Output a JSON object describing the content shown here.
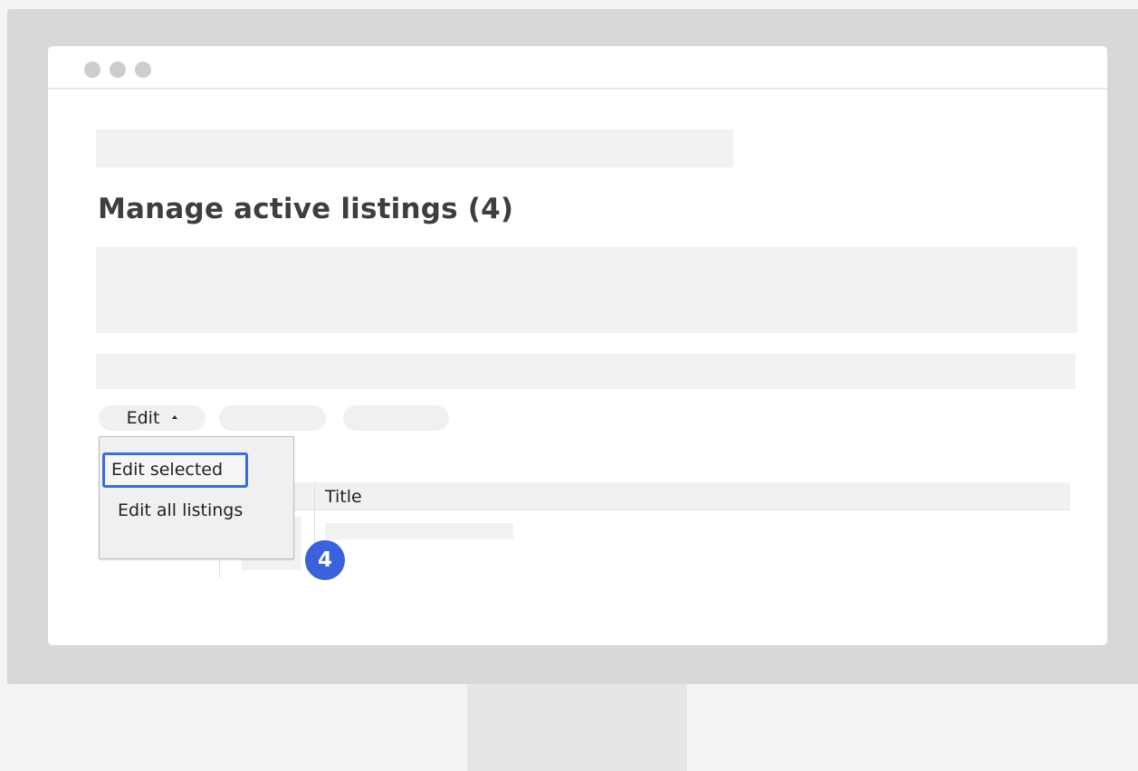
{
  "page": {
    "title": "Manage active listings (4)"
  },
  "toolbar": {
    "edit_label": "Edit",
    "caret_icon": "caret-up-icon"
  },
  "dropdown": {
    "items": [
      {
        "label": "Edit selected",
        "state": "focused"
      },
      {
        "label": "Edit all listings"
      }
    ]
  },
  "table": {
    "columns": [
      "",
      "",
      "Title"
    ]
  },
  "annotation": {
    "step_number": "4"
  },
  "colors": {
    "accent": "#3b62dc",
    "focus_outline": "#3b6de0",
    "placeholder": "#f2f2f2",
    "bezel": "#d8d8d8"
  }
}
